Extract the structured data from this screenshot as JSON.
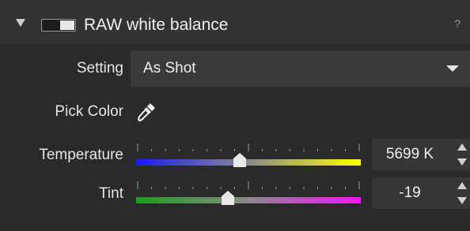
{
  "panel": {
    "title": "RAW white balance",
    "help_label": "?",
    "toggle_on": true
  },
  "setting": {
    "label": "Setting",
    "value": "As Shot"
  },
  "pick_color": {
    "label": "Pick Color",
    "icon": "eyedropper-icon"
  },
  "temperature": {
    "label": "Temperature",
    "value": "5699 K",
    "slider_fraction": 0.46,
    "gradient": [
      "#1a1aff",
      "#ffff00"
    ]
  },
  "tint": {
    "label": "Tint",
    "value": "-19",
    "slider_fraction": 0.41,
    "gradient": [
      "#1e9a1e",
      "#ff10ff"
    ]
  }
}
